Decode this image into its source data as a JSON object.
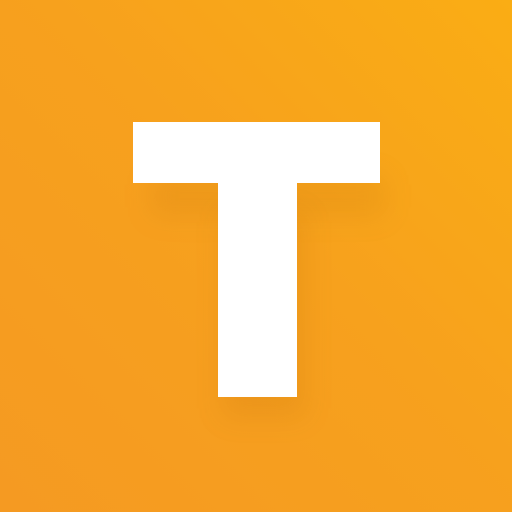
{
  "app_icon": {
    "letter": "T",
    "background_color": "#F7A11E",
    "letter_color": "#FFFFFF"
  }
}
